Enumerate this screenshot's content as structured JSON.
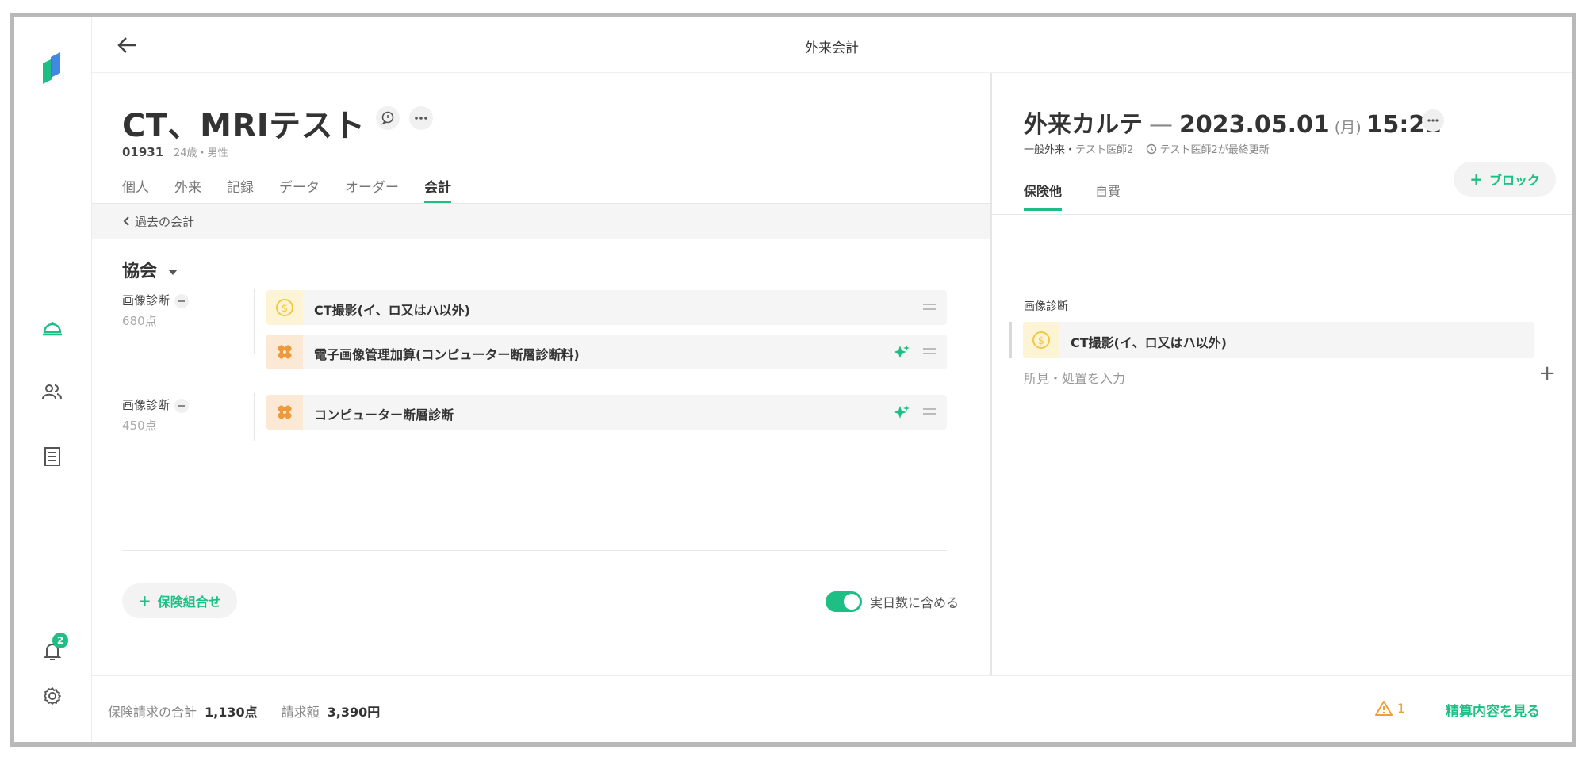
{
  "header": {
    "title": "外来会計"
  },
  "sidebar": {
    "notification_count": "2"
  },
  "patient": {
    "name": "CT、MRIテスト",
    "id": "01931",
    "info": "24歳・男性"
  },
  "tabs": [
    "個人",
    "外来",
    "記録",
    "データ",
    "オーダー",
    "会計"
  ],
  "past_accounts": "過去の会計",
  "group": {
    "title": "協会"
  },
  "sections": [
    {
      "label": "画像診断",
      "points": "680点",
      "items": [
        {
          "text": "CT撮影(イ、ロ又はハ以外)",
          "icon": "coin-icon"
        },
        {
          "text": "電子画像管理加算(コンピューター断層診断料)",
          "icon": "bandage-icon"
        }
      ]
    },
    {
      "label": "画像診断",
      "points": "450点",
      "items": [
        {
          "text": "コンピューター断層診断",
          "icon": "bandage-icon"
        }
      ]
    }
  ],
  "combo_button": "保険組合せ",
  "toggle_label": "実日数に含める",
  "chart": {
    "title_main": "外来カルテ",
    "dash": "—",
    "date": "2023.05.01",
    "dow": "(月)",
    "time": "15:22",
    "meta_type": "一般外来・",
    "meta_doctor": "テスト医師2",
    "meta_update": "テスト医師2が最終更新",
    "block_button": "ブロック",
    "tabs": [
      "保険他",
      "自費"
    ],
    "section_label": "画像診断",
    "item": "CT撮影(イ、ロ又はハ以外)",
    "input_placeholder": "所見・処置を入力"
  },
  "footer": {
    "total_label": "保険請求の合計",
    "total_value": "1,130点",
    "billed_label": "請求額",
    "billed_value": "3,390円",
    "warning_count": "1",
    "detail_link": "精算内容を見る"
  },
  "colors": {
    "accent": "#1dbf85",
    "warning": "#f0a030",
    "coin": "#f2c744",
    "bandage": "#ec9a3c"
  }
}
